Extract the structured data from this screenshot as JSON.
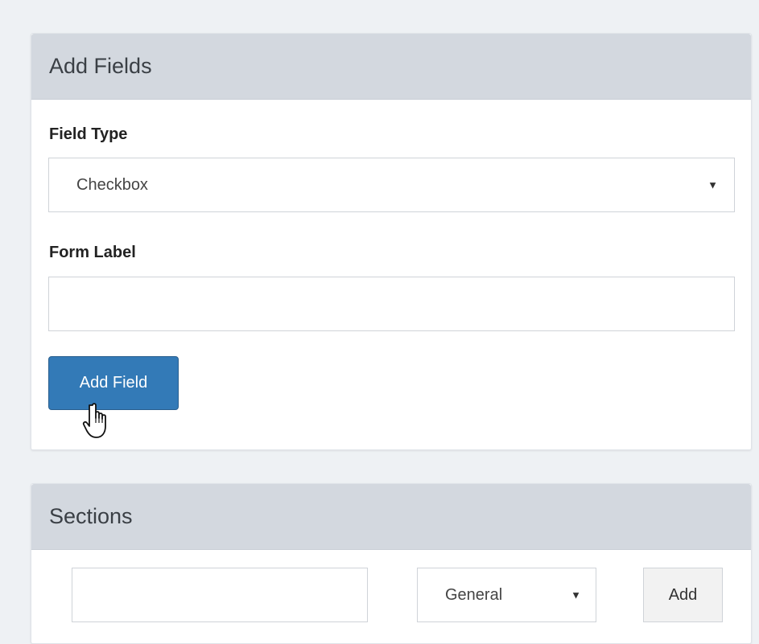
{
  "add_fields": {
    "title": "Add Fields",
    "field_type_label": "Field Type",
    "field_type_value": "Checkbox",
    "form_label_label": "Form Label",
    "form_label_value": "",
    "add_field_button": "Add Field"
  },
  "sections": {
    "title": "Sections",
    "name_value": "",
    "category_value": "General",
    "add_button": "Add"
  },
  "colors": {
    "primary_button": "#337ab7",
    "panel_header": "#d3d8df",
    "page_background": "#eef1f4"
  },
  "icons": {
    "cursor": "hand-pointer-icon",
    "dropdown": "triangle-down-icon"
  }
}
